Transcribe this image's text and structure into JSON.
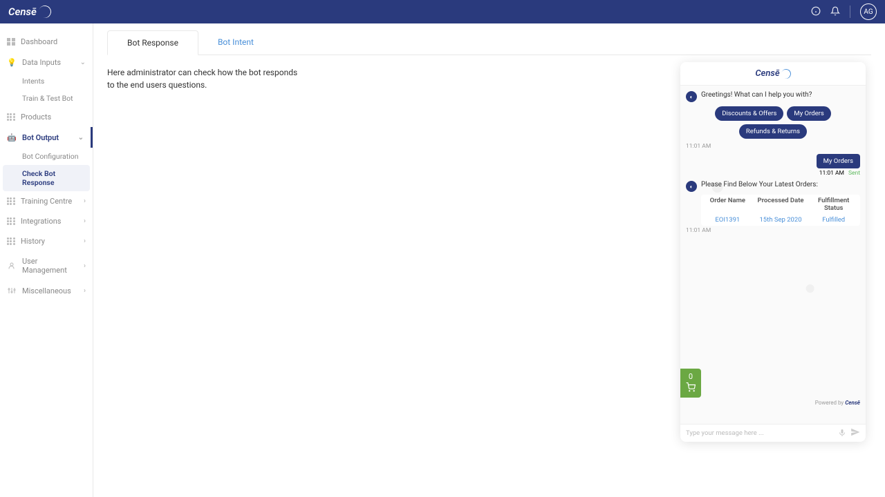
{
  "header": {
    "logo": "Censē",
    "avatar": "AG"
  },
  "sidebar": {
    "dashboard": "Dashboard",
    "dataInputs": "Data Inputs",
    "intents": "Intents",
    "trainTest": "Train & Test Bot",
    "products": "Products",
    "botOutput": "Bot Output",
    "botConfig": "Bot Configuration",
    "checkResponse": "Check Bot Response",
    "trainingCentre": "Training Centre",
    "integrations": "Integrations",
    "history": "History",
    "userMgmt": "User Management",
    "misc": "Miscellaneous"
  },
  "tabs": {
    "botResponse": "Bot Response",
    "botIntent": "Bot Intent"
  },
  "description": "Here administrator can check how the bot responds to the end users questions.",
  "chat": {
    "greeting": "Greetings! What can I help you with?",
    "chips": {
      "discounts": "Discounts & Offers",
      "myOrders": "My Orders",
      "refunds": "Refunds & Returns"
    },
    "ts1": "11:01 AM",
    "userMsg": "My Orders",
    "userTs": "11:01 AM",
    "sent": "Sent",
    "ordersIntro": "Please Find Below Your Latest Orders:",
    "table": {
      "hOrder": "Order Name",
      "hDate": "Processed Date",
      "hStatus": "Fulfillment Status",
      "order": "EOI1391",
      "date": "15th Sep 2020",
      "status": "Fulfilled"
    },
    "ts2": "11:01 AM",
    "cartCount": "0",
    "powered": "Powered by ",
    "poweredBrand": "Censē",
    "placeholder": "Type your message here ..."
  }
}
